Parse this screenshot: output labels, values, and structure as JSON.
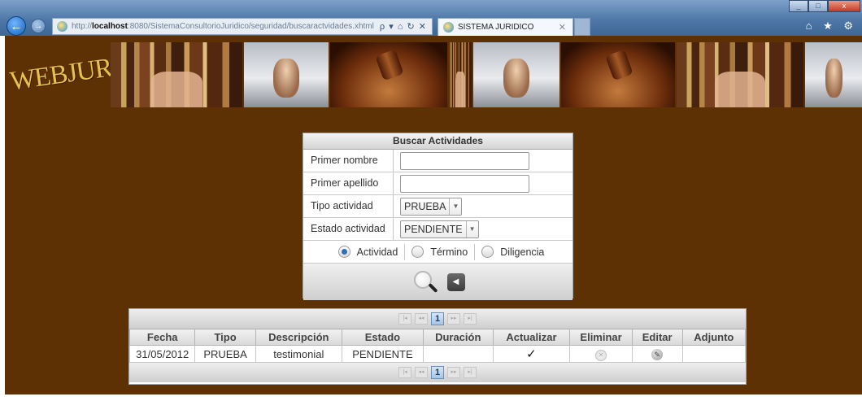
{
  "browser": {
    "url_prefix": "http://",
    "url_host": "localhost",
    "url_path": ":8080/SistemaConsultorioJuridico/seguridad/buscaractvidades.xhtml",
    "address_tools": "ρ ▾ ⌂ ↻ ✕",
    "tab_title": "SISTEMA JURIDICO",
    "tab_close": "✕",
    "toolbar_icons": "⌂ ★ ⚙",
    "win_min": "_",
    "win_max": "□",
    "win_close": "x",
    "back_arrow": "←",
    "forward_arrow": "→"
  },
  "banner": {
    "logo": "WEBJURIS"
  },
  "search_panel": {
    "title": "Buscar Actividades",
    "first_name_label": "Primer nombre",
    "first_name_value": "",
    "last_name_label": "Primer apellido",
    "last_name_value": "",
    "activity_type_label": "Tipo actividad",
    "activity_type_value": "PRUEBA",
    "activity_state_label": "Estado actividad",
    "activity_state_value": "PENDIENTE",
    "dropdown_arrow": "▼",
    "radios": [
      {
        "label": "Actividad",
        "selected": true
      },
      {
        "label": "Término",
        "selected": false
      },
      {
        "label": "Diligencia",
        "selected": false
      }
    ],
    "back_glyph": "◀"
  },
  "results": {
    "paginator": {
      "first": "|◂",
      "prev": "◂◂",
      "current_page": "1",
      "next": "▸▸",
      "last": "▸|"
    },
    "columns": [
      "Fecha",
      "Tipo",
      "Descripción",
      "Estado",
      "Duración",
      "Actualizar",
      "Eliminar",
      "Editar",
      "Adjunto"
    ],
    "rows": [
      {
        "fecha": "31/05/2012",
        "tipo": "PRUEBA",
        "descripcion": "testimonial",
        "estado": "PENDIENTE",
        "duracion": "",
        "actualizar": "✓",
        "eliminar": "✕",
        "editar": "✎",
        "adjunto": ""
      }
    ]
  },
  "colors": {
    "page_background": "#5e3104",
    "logo": "#e6c14d",
    "selected_radio": "#2f6fb5"
  }
}
